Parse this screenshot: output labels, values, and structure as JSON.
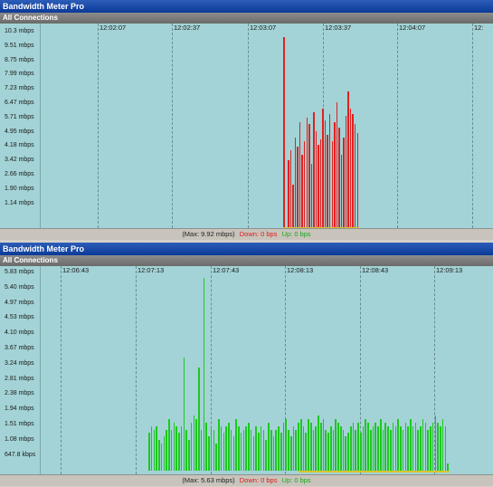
{
  "panels": [
    {
      "title": "Bandwidth Meter Pro",
      "subtitle": "All Connections",
      "status": {
        "max": "(Max: 9.92 mbps)",
        "down": "Down: 0 bps",
        "up": "Up: 0 bps"
      },
      "colors": {
        "bars": "#e02020",
        "grid": "#6a8c90",
        "background": "#a3d3d6"
      },
      "chart_data": {
        "type": "bar",
        "y_ticks": [
          "10.3 mbps",
          "9.51 mbps",
          "8.75 mbps",
          "7.99 mbps",
          "7.23 mbps",
          "6.47 mbps",
          "5.71 mbps",
          "4.95 mbps",
          "4.18 mbps",
          "3.42 mbps",
          "2.66 mbps",
          "1.90 mbps",
          "1.14 mbps"
        ],
        "x_ticks": [
          "12:02:07",
          "12:02:37",
          "12:03:07",
          "12:03:37",
          "12:04:07",
          "12:"
        ],
        "ylim": [
          0,
          10.3
        ],
        "series": [
          {
            "name": "Down",
            "values": [
              9.92,
              0,
              3.5,
              4.0,
              2.2,
              4.7,
              4.2,
              5.5,
              3.8,
              4.5,
              5.7,
              5.4,
              3.3,
              6.0,
              5.0,
              4.3,
              4.6,
              6.2,
              5.6,
              4.8,
              5.9,
              4.5,
              5.5,
              6.5,
              5.2,
              3.8,
              4.7,
              5.8,
              7.1,
              6.2,
              5.9,
              5.4,
              4.9
            ]
          }
        ]
      }
    },
    {
      "title": "Bandwidth Meter Pro",
      "subtitle": "All Connections",
      "status": {
        "max": "(Max: 5.63 mbps)",
        "down": "Down: 0 bps",
        "up": "Up: 0 bps"
      },
      "colors": {
        "bars": "#1ec81e",
        "grid": "#6a8c90",
        "background": "#a3d3d6"
      },
      "chart_data": {
        "type": "bar",
        "y_ticks": [
          "5.83 mbps",
          "5.40 mbps",
          "4.97 mbps",
          "4.53 mbps",
          "4.10 mbps",
          "3.67 mbps",
          "3.24 mbps",
          "2.81 mbps",
          "2.38 mbps",
          "1.94 mbps",
          "1.51 mbps",
          "1.08 mbps",
          "647.8 kbps"
        ],
        "x_ticks": [
          "12:06:43",
          "12:07:13",
          "12:07:43",
          "12:08:13",
          "12:08:43",
          "12:09:13"
        ],
        "ylim": [
          0,
          5.83
        ],
        "series": [
          {
            "name": "Up",
            "values": [
              1.1,
              1.3,
              1.2,
              1.3,
              0.9,
              0.8,
              1.0,
              1.2,
              1.5,
              1.2,
              1.4,
              1.3,
              1.1,
              1.3,
              3.3,
              1.2,
              0.9,
              1.4,
              1.6,
              1.5,
              3.0,
              1.2,
              5.63,
              1.4,
              1.0,
              1.3,
              1.2,
              0.8,
              1.5,
              1.3,
              1.1,
              1.3,
              1.4,
              1.2,
              1.0,
              1.5,
              1.3,
              1.1,
              1.2,
              1.3,
              1.4,
              1.2,
              1.0,
              1.3,
              1.1,
              1.3,
              1.2,
              0.9,
              1.4,
              1.2,
              1.0,
              1.2,
              1.3,
              1.1,
              1.4,
              1.5,
              1.2,
              1.0,
              1.3,
              1.2,
              1.4,
              1.5,
              1.3,
              1.1,
              1.5,
              1.4,
              1.2,
              1.3,
              1.6,
              1.4,
              1.5,
              1.2,
              1.1,
              1.3,
              1.2,
              1.5,
              1.4,
              1.3,
              1.2,
              1.0,
              1.1,
              1.3,
              1.4,
              1.2,
              1.4,
              1.1,
              1.3,
              1.5,
              1.4,
              1.2,
              1.3,
              1.4,
              1.3,
              1.5,
              1.2,
              1.4,
              1.3,
              1.2,
              1.4,
              1.3,
              1.5,
              1.3,
              1.2,
              1.4,
              1.3,
              1.5,
              1.3,
              1.4,
              1.2,
              1.3,
              1.5,
              1.4,
              1.2,
              1.3,
              1.4,
              1.6,
              1.4,
              1.3,
              1.5,
              1.3,
              0.2
            ]
          }
        ]
      }
    }
  ]
}
